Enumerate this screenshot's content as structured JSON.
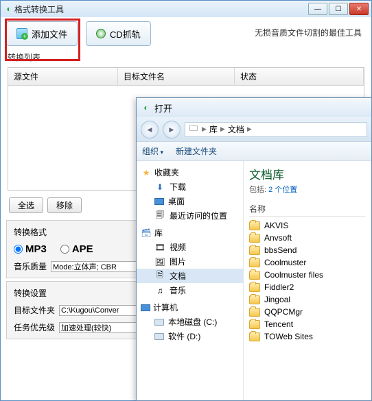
{
  "window": {
    "title": "格式转换工具",
    "tagline": "无损音质文件切割的最佳工具"
  },
  "toolbar": {
    "add_file": "添加文件",
    "cd_rip": "CD抓轨"
  },
  "list": {
    "label": "转换列表",
    "col_src": "源文件",
    "col_dst": "目标文件名",
    "col_stat": "状态"
  },
  "buttons": {
    "select_all": "全选",
    "remove": "移除"
  },
  "format": {
    "title": "转换格式",
    "mp3": "MP3",
    "ape": "APE",
    "quality_label": "音乐质量",
    "quality_value": "Mode:立体声; CBR"
  },
  "settings": {
    "title": "转换设置",
    "target_label": "目标文件夹",
    "target_value": "C:\\Kugou\\Conver",
    "priority_label": "任务优先级",
    "priority_value": "加速处理(较快)"
  },
  "dialog": {
    "title": "打开",
    "breadcrumb": {
      "root": "库",
      "current": "文档"
    },
    "organize": "组织",
    "new_folder": "新建文件夹",
    "tree": {
      "favorites": "收藏夹",
      "downloads": "下载",
      "desktop": "桌面",
      "recent": "最近访问的位置",
      "library": "库",
      "videos": "视频",
      "pictures": "图片",
      "documents": "文档",
      "music": "音乐",
      "computer": "计算机",
      "local_c": "本地磁盘 (C:)",
      "soft_d": "软件 (D:)"
    },
    "main": {
      "lib_title": "文档库",
      "lib_sub_prefix": "包括: ",
      "lib_sub_link": "2 个位置",
      "col_name": "名称",
      "files": [
        "AKVIS",
        "Anvsoft",
        "bbsSend",
        "Coolmuster",
        "Coolmuster files",
        "Fiddler2",
        "Jingoal",
        "QQPCMgr",
        "Tencent",
        "TOWeb Sites"
      ]
    }
  }
}
